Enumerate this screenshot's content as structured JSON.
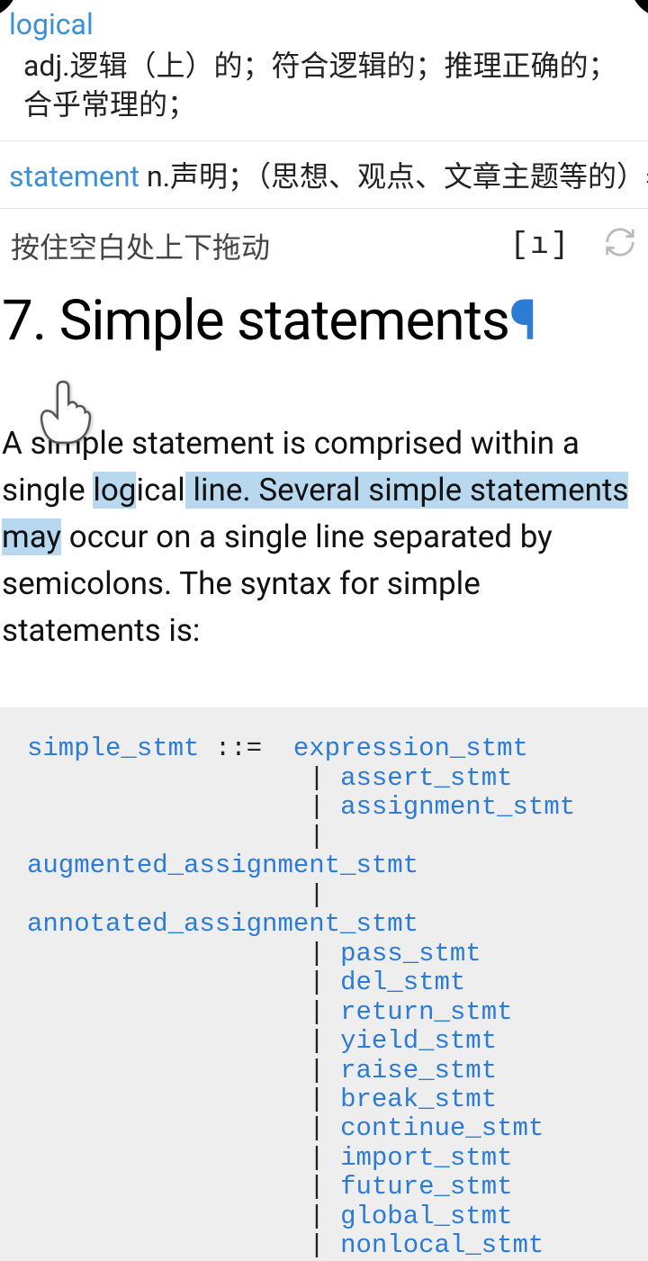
{
  "dict": {
    "entry1": {
      "word": "logical",
      "definition": "adj.逻辑（上）的；符合逻辑的；推理正确的；合乎常理的；"
    },
    "entry2": {
      "word": "statement",
      "definition": " n.声明；（思想、观点、文章主题等的）表"
    }
  },
  "toolbar": {
    "hint": "按住空白处上下拖动",
    "brackets": "[ı]"
  },
  "heading": {
    "number": "7. ",
    "title": "Simple statements",
    "pilcrow": "¶"
  },
  "paragraph": {
    "pre": "A simple statement is comprised within a single ",
    "hl1": "log",
    "mid1": "ical",
    "hl2": " line. Several simple statements may",
    "post": " occur on a single line separated by semicolons. The syntax for simple statements is:"
  },
  "code": {
    "lhs": "simple_stmt",
    "op": " ::=  ",
    "indent": "                 ",
    "pipe": " | ",
    "items": [
      "expression_stmt",
      "assert_stmt",
      "assignment_stmt",
      "augmented_assignment_stmt",
      "annotated_assignment_stmt",
      "pass_stmt",
      "del_stmt",
      "return_stmt",
      "yield_stmt",
      "raise_stmt",
      "break_stmt",
      "continue_stmt",
      "import_stmt",
      "future_stmt",
      "global_stmt",
      "nonlocal_stmt"
    ]
  }
}
